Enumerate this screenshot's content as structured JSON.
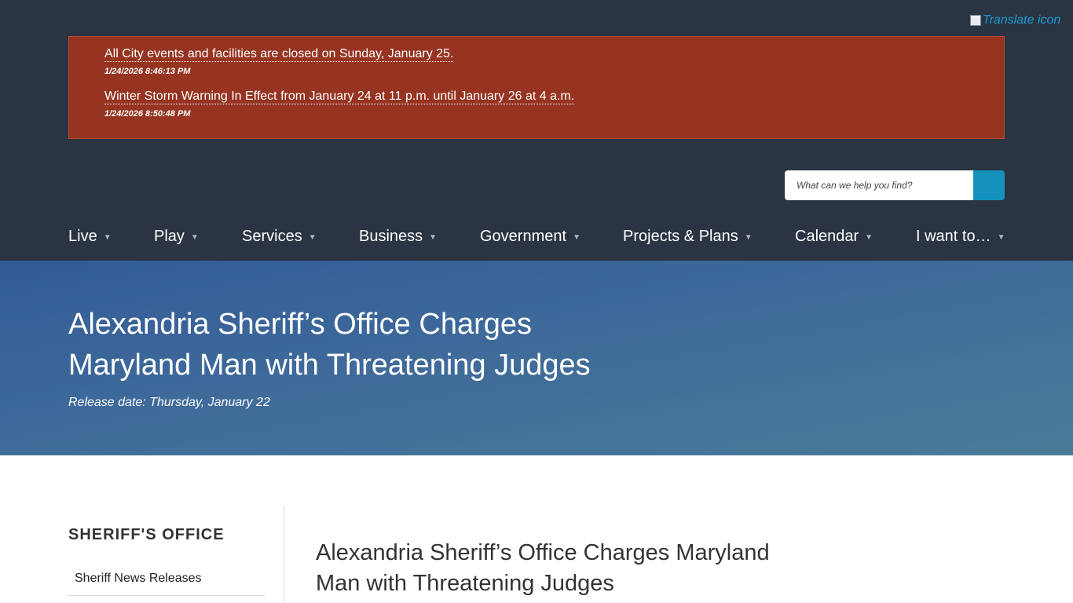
{
  "translate": {
    "alt_text": "Translate icon"
  },
  "alerts": [
    {
      "text": "All City events and facilities are closed on Sunday, January 25.",
      "timestamp": "1/24/2026 8:46:13 PM"
    },
    {
      "text": "Winter Storm Warning In Effect from January 24 at 11 p.m. until January 26 at 4 a.m.",
      "timestamp": "1/24/2026 8:50:48 PM"
    }
  ],
  "search": {
    "placeholder": "What can we help you find?"
  },
  "nav": {
    "items": [
      {
        "label": "Live"
      },
      {
        "label": "Play"
      },
      {
        "label": "Services"
      },
      {
        "label": "Business"
      },
      {
        "label": "Government"
      },
      {
        "label": "Projects & Plans"
      },
      {
        "label": "Calendar"
      },
      {
        "label": "I want to…"
      }
    ],
    "caret": "▼"
  },
  "hero": {
    "title": "Alexandria Sheriff’s Office Charges Maryland Man with Threatening Judges",
    "release_date": "Release date: Thursday, January 22"
  },
  "sidebar": {
    "title": "SHERIFF'S OFFICE",
    "links": [
      {
        "label": "Sheriff News Releases"
      }
    ]
  },
  "content": {
    "title": "Alexandria Sheriff’s Office Charges Maryland Man with Threatening Judges"
  },
  "colors": {
    "header_bg": "#2a3442",
    "alert_bg": "#963421",
    "search_button": "#1591bd",
    "hero_start": "#325b97",
    "hero_end": "#4a7b98",
    "link": "#1a9ad6"
  }
}
